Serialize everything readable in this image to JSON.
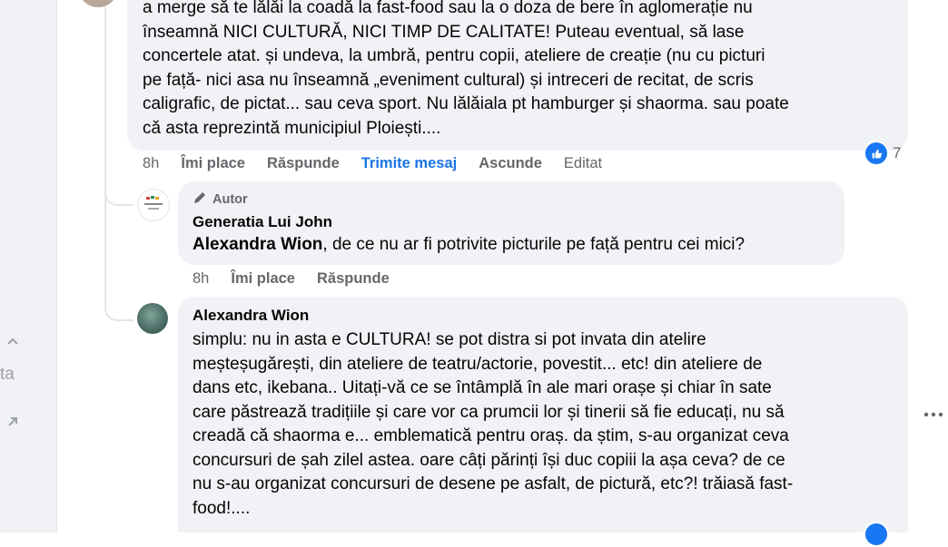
{
  "comment_top": {
    "lines": [
      "a merge să te lălăi la coadă la fast-food sau la o doza de bere în aglomerație nu",
      "înseamnă NICI CULTURĂ, NICI TIMP DE CALITATE! Puteau eventual, să lase",
      "concertele atat. și undeva, la umbră, pentru copii, ateliere de creație (nu cu picturi",
      "pe față- nici asa nu înseamnă „eveniment cultural) și intreceri de recitat, de scris",
      "caligrafic, de pictat... sau ceva sport. Nu lălăiala pt hamburger și shaorma. sau poate",
      "că asta reprezintă municipiul Ploiești...."
    ],
    "time": "8h",
    "like_label": "Îmi place",
    "reply_label": "Răspunde",
    "send_message_label": "Trimite mesaj",
    "hide_label": "Ascunde",
    "edited_label": "Editat",
    "reaction_count": "7",
    "reaction_icon": "like-icon"
  },
  "reply_author": {
    "badge_label": "Autor",
    "badge_icon": "pencil-icon",
    "name": "Generatia Lui John",
    "mention": "Alexandra Wion",
    "text": ", de ce nu ar fi potrivite picturile pe față pentru cei mici?",
    "time": "8h",
    "like_label": "Îmi place",
    "reply_label": "Răspunde"
  },
  "reply_alexandra": {
    "name": "Alexandra Wion",
    "lines": [
      "simplu: nu in asta e CULTURA! se pot distra si pot invata din atelire",
      "meșteșugărești, din ateliere de teatru/actorie, povestit... etc! din ateliere de",
      "dans etc, ikebana.. Uitați-vă ce se întâmplă în ale mari orașe și chiar în sate",
      "care păstrează tradițiile și care vor ca prumcii lor și tinerii să fie educați, nu să",
      "creadă că shaorma e... emblematică pentru oraș. da știm, s-au organizat ceva",
      "concursuri de șah zilel astea. oare câți părinți își duc copiii la așa ceva? de ce",
      "nu s-au organizat concursuri de desene pe asfalt, de pictură, etc?! trăiasă fast-",
      "food!...."
    ],
    "more_icon": "more-options-icon"
  },
  "sidebar": {
    "icons": [
      "chevron-up-icon",
      "arrow-up-right-icon"
    ],
    "partial_text": "ta"
  },
  "colors": {
    "bubble": "#f0f2f5",
    "link": "#1b74e4",
    "meta": "#65676b",
    "like": "#1877f2"
  }
}
